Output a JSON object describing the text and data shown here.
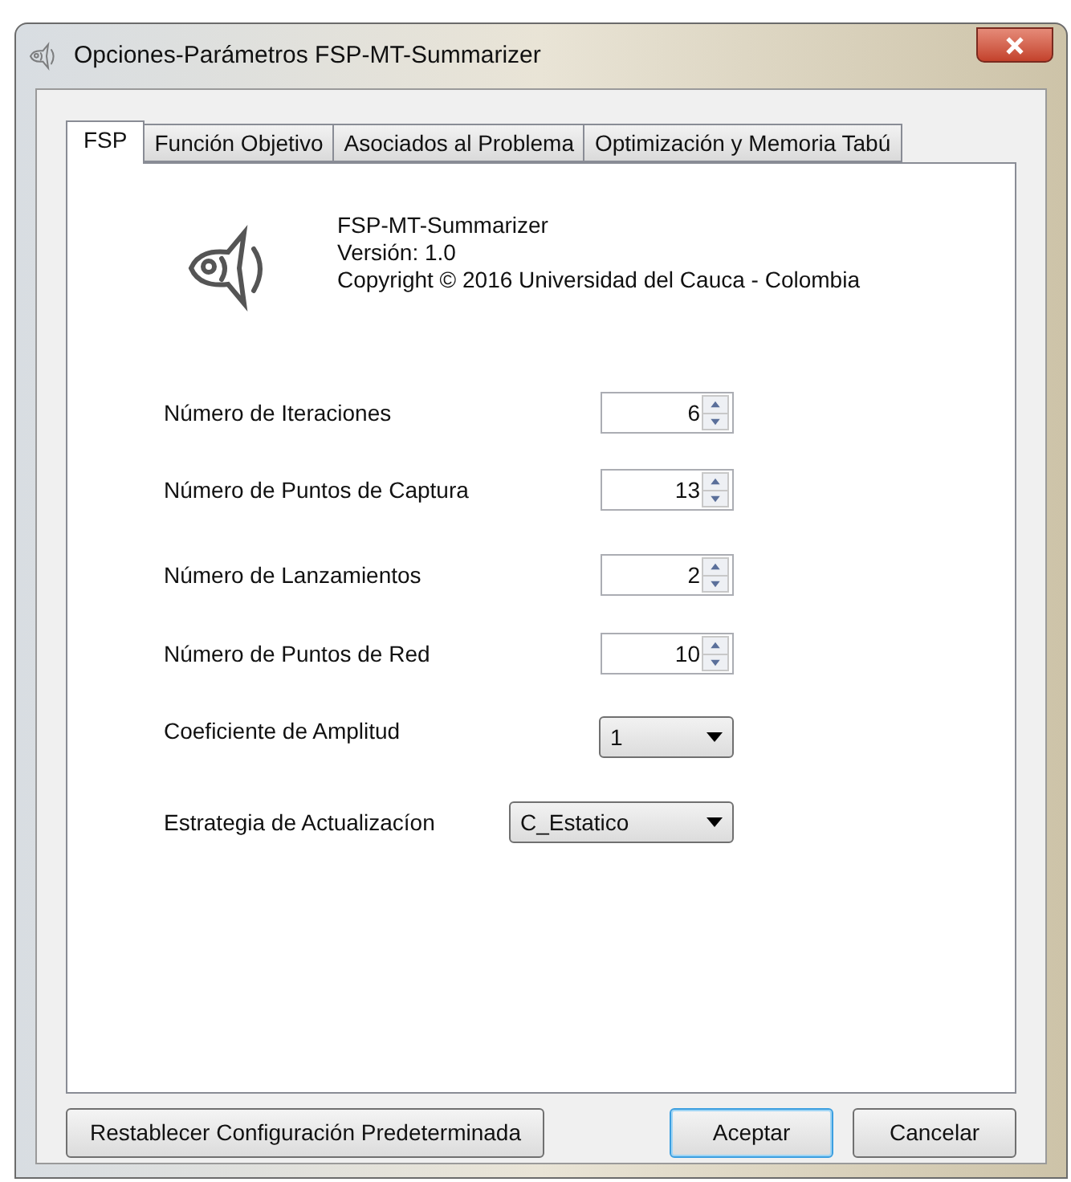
{
  "window": {
    "title": "Opciones-Parámetros FSP-MT-Summarizer"
  },
  "tabs": [
    {
      "label": "FSP",
      "selected": true
    },
    {
      "label": "Función Objetivo",
      "selected": false
    },
    {
      "label": "Asociados al Problema",
      "selected": false
    },
    {
      "label": "Optimización y Memoria Tabú",
      "selected": false
    }
  ],
  "about": {
    "name": "FSP-MT-Summarizer",
    "version": "Versión: 1.0",
    "copyright": "Copyright © 2016  Universidad del Cauca - Colombia"
  },
  "parameters": [
    {
      "kind": "spinner",
      "label": "Número de Iteraciones",
      "value": "6"
    },
    {
      "kind": "spinner",
      "label": "Número de Puntos de Captura",
      "value": "13"
    },
    {
      "kind": "spinner",
      "label": "Número de Lanzamientos",
      "value": "2"
    },
    {
      "kind": "spinner",
      "label": "Número de Puntos de Red",
      "value": "10"
    },
    {
      "kind": "combo",
      "label": "Coeficiente de Amplitud",
      "value": "1"
    },
    {
      "kind": "combo_wide",
      "label": "Estrategia de Actualizacíon",
      "value": "C_Estatico"
    }
  ],
  "buttons": [
    {
      "label": "Restablecer Configuración Predeterminada",
      "default": false
    },
    {
      "label": "Aceptar",
      "default": true
    },
    {
      "label": "Cancelar",
      "default": false
    }
  ]
}
